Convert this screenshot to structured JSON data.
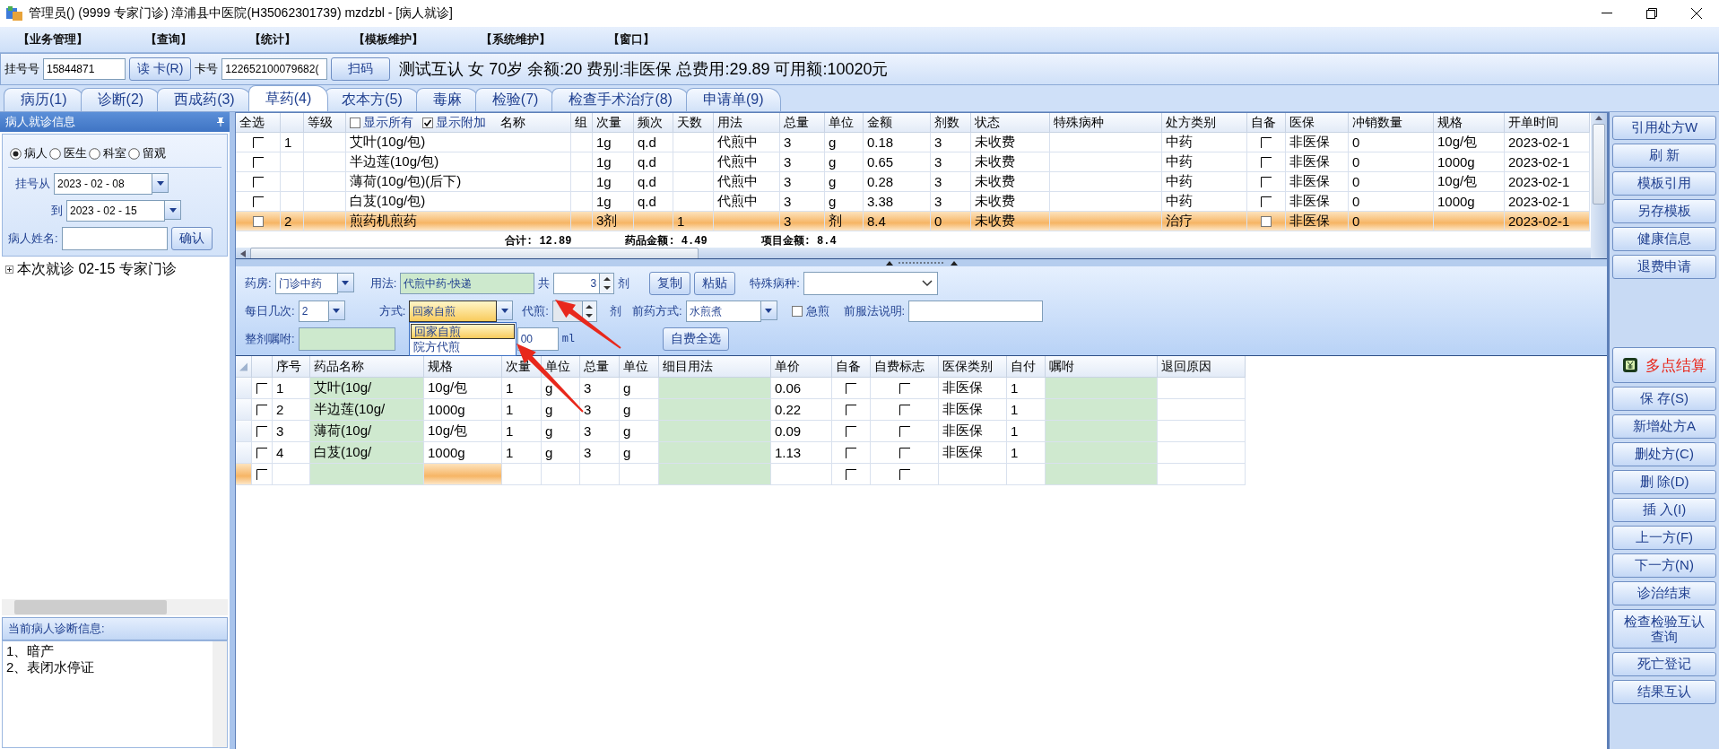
{
  "window": {
    "title": "管理员() (9999 专家门诊) 漳浦县中医院(H35062301739) mzdzbl - [病人就诊]"
  },
  "menu": [
    "【业务管理】",
    "【查询】",
    "【统计】",
    "【模板维护】",
    "【系统维护】",
    "【窗口】"
  ],
  "patient_bar": {
    "registration": {
      "label": "挂号号",
      "value": "15844871"
    },
    "read_card_button": "读 卡(R)",
    "card": {
      "label": "卡号",
      "value": "122652100079682("
    },
    "scan_button": "扫码",
    "info": "测试互认 女 70岁 余额:20 费别:非医保 总费用:29.89 可用额:10020元"
  },
  "tabs": [
    {
      "label": "病历(1)",
      "selected": false
    },
    {
      "label": "诊断(2)",
      "selected": false
    },
    {
      "label": "西成药(3)",
      "selected": false
    },
    {
      "label": "草药(4)",
      "selected": true
    },
    {
      "label": "农本方(5)",
      "selected": false
    },
    {
      "label": "毒麻",
      "selected": false
    },
    {
      "label": "检验(7)",
      "selected": false
    },
    {
      "label": "检查手术治疗(8)",
      "selected": false
    },
    {
      "label": "申请单(9)",
      "selected": false
    }
  ],
  "left_panel": {
    "title": "病人就诊信息",
    "scope": [
      {
        "label": "病人",
        "selected": true
      },
      {
        "label": "医生",
        "selected": false
      },
      {
        "label": "科室",
        "selected": false
      },
      {
        "label": "留观",
        "selected": false
      }
    ],
    "date_from": {
      "label": "挂号从",
      "value": "2023 - 02 - 08"
    },
    "date_to": {
      "label": "到",
      "value": "2023 - 02 - 15"
    },
    "patient_name": {
      "label": "病人姓名:"
    },
    "confirm_button": "确认",
    "tree": [
      {
        "label": "本次就诊 02-15 专家门诊",
        "expanded": false
      }
    ],
    "diagnosis": {
      "title": "当前病人诊断信息:",
      "lines": [
        "1、暗产",
        "2、表闭水停证"
      ]
    }
  },
  "top_table": {
    "columns": [
      {
        "label": "全选"
      },
      {
        "kind": "blank"
      },
      {
        "label": "等级"
      },
      {
        "kind": "name",
        "label": "名称",
        "toggles": [
          {
            "label": "显示所有",
            "checked": false
          },
          {
            "label": "显示附加",
            "checked": true
          }
        ]
      },
      {
        "label": "组"
      },
      {
        "label": "次量"
      },
      {
        "label": "频次"
      },
      {
        "label": "天数"
      },
      {
        "label": "用法"
      },
      {
        "label": "总量"
      },
      {
        "label": "单位"
      },
      {
        "label": "金额"
      },
      {
        "label": "剂数"
      },
      {
        "label": "状态"
      },
      {
        "label": "特殊病种"
      },
      {
        "label": "处方类别"
      },
      {
        "label": "自备"
      },
      {
        "label": "医保"
      },
      {
        "label": "冲销数量"
      },
      {
        "label": "规格"
      },
      {
        "label": "开单时间"
      }
    ],
    "rows": [
      {
        "selected": false,
        "checked": false,
        "group_no": "1",
        "name": "艾叶(10g/包)",
        "dose": "1g",
        "frequency": "q.d",
        "usage": "代煎中",
        "total": "3",
        "unit": "g",
        "amount": "0.18",
        "doses": "3",
        "status": "未收费",
        "rx_type": "中药",
        "self_supplied": false,
        "insurance": "非医保",
        "offset_qty": "0",
        "spec": "10g/包",
        "start_time": "2023-02-1"
      },
      {
        "selected": false,
        "checked": false,
        "name": "半边莲(10g/包)",
        "dose": "1g",
        "frequency": "q.d",
        "usage": "代煎中",
        "total": "3",
        "unit": "g",
        "amount": "0.65",
        "doses": "3",
        "status": "未收费",
        "rx_type": "中药",
        "self_supplied": false,
        "insurance": "非医保",
        "offset_qty": "0",
        "spec": "1000g",
        "start_time": "2023-02-1"
      },
      {
        "selected": false,
        "checked": false,
        "name": "薄荷(10g/包)(后下)",
        "dose": "1g",
        "frequency": "q.d",
        "usage": "代煎中",
        "total": "3",
        "unit": "g",
        "amount": "0.28",
        "doses": "3",
        "status": "未收费",
        "rx_type": "中药",
        "self_supplied": false,
        "insurance": "非医保",
        "offset_qty": "0",
        "spec": "10g/包",
        "start_time": "2023-02-1"
      },
      {
        "selected": false,
        "checked": false,
        "name": "白芨(10g/包)",
        "dose": "1g",
        "frequency": "q.d",
        "usage": "代煎中",
        "total": "3",
        "unit": "g",
        "amount": "3.38",
        "doses": "3",
        "status": "未收费",
        "rx_type": "中药",
        "self_supplied": false,
        "insurance": "非医保",
        "offset_qty": "0",
        "spec": "1000g",
        "start_time": "2023-02-1"
      },
      {
        "selected": true,
        "checked": false,
        "group_no": "2",
        "name": "煎药机煎药",
        "dose": "3剂",
        "days": "1",
        "total": "3",
        "unit": "剂",
        "amount": "8.4",
        "doses": "0",
        "status": "未收费",
        "rx_type": "治疗",
        "self_supplied": false,
        "insurance": "非医保",
        "offset_qty": "0",
        "start_time": "2023-02-1"
      }
    ],
    "summary": [
      {
        "label": "合计:",
        "value": "12.89"
      },
      {
        "label": "药品金额:",
        "value": "4.49"
      },
      {
        "label": "项目金额:",
        "value": "8.4"
      }
    ]
  },
  "form": {
    "pharmacy": {
      "label": "药房:",
      "value": "门诊中药"
    },
    "usage": {
      "label": "用法:",
      "value": "代煎中药-快递"
    },
    "total": {
      "label": "共",
      "value": "3",
      "unit": "剂"
    },
    "copy_button": "复制",
    "paste_button": "粘贴",
    "special_disease": {
      "label": "特殊病种:"
    },
    "daily_times": {
      "label": "每日几次:",
      "value": "2"
    },
    "method": {
      "label": "方式:",
      "value": "回家自煎",
      "expanded": true,
      "options": [
        {
          "label": "回家自煎",
          "selected": true
        },
        {
          "label": "院方代煎",
          "selected": false
        }
      ]
    },
    "decoct": {
      "label": "代煎:",
      "unit": "剂",
      "disabled": true
    },
    "decoct_method": {
      "label": "前药方式:",
      "value": "水煎煮"
    },
    "urgent": {
      "label": "急煎",
      "checked": false
    },
    "instructions": {
      "label": "前服法说明:"
    },
    "whole_advice": {
      "label": "整剂嘱咐:"
    },
    "volume": {
      "value": "00",
      "unit": "ml"
    },
    "self_pay_all_button": "自费全选"
  },
  "bottom_table": {
    "columns": [
      "序号",
      "药品名称",
      "规格",
      "次量",
      "单位",
      "总量",
      "单位",
      "细目用法",
      "单价",
      "自备",
      "自费标志",
      "医保类别",
      "自付",
      "嘱咐",
      "退回原因"
    ],
    "rows": [
      {
        "current": false,
        "checked": false,
        "no": "1",
        "name": "艾叶(10g/",
        "spec": "10g/包",
        "dose": "1",
        "unit": "g",
        "total": "3",
        "total_unit": "g",
        "price": "0.06",
        "self_supplied": false,
        "self_pay": false,
        "insurance_type": "非医保",
        "self_pay_ratio": "1"
      },
      {
        "current": false,
        "checked": false,
        "no": "2",
        "name": "半边莲(10g/",
        "spec": "1000g",
        "dose": "1",
        "unit": "g",
        "total": "3",
        "total_unit": "g",
        "price": "0.22",
        "self_supplied": false,
        "self_pay": false,
        "insurance_type": "非医保",
        "self_pay_ratio": "1"
      },
      {
        "current": false,
        "checked": false,
        "no": "3",
        "name": "薄荷(10g/",
        "spec": "10g/包",
        "dose": "1",
        "unit": "g",
        "total": "3",
        "total_unit": "g",
        "price": "0.09",
        "self_supplied": false,
        "self_pay": false,
        "insurance_type": "非医保",
        "self_pay_ratio": "1"
      },
      {
        "current": false,
        "checked": false,
        "no": "4",
        "name": "白芨(10g/",
        "spec": "1000g",
        "dose": "1",
        "unit": "g",
        "total": "3",
        "total_unit": "g",
        "price": "1.13",
        "self_supplied": false,
        "self_pay": false,
        "insurance_type": "非医保",
        "self_pay_ratio": "1"
      },
      {
        "current": true,
        "checked": false,
        "self_supplied": false,
        "self_pay": false
      }
    ]
  },
  "right_buttons": [
    {
      "label": "引用处方W",
      "kind": "plain"
    },
    {
      "label": "刷 新",
      "kind": "plain"
    },
    {
      "label": "模板引用",
      "kind": "plain"
    },
    {
      "label": "另存模板",
      "kind": "plain"
    },
    {
      "label": "健康信息",
      "kind": "plain"
    },
    {
      "label": "退费申请",
      "kind": "plain"
    },
    {
      "label": "多点结算",
      "kind": "settle"
    },
    {
      "label": "保 存(S)",
      "kind": "plain"
    },
    {
      "label": "新增处方A",
      "kind": "plain"
    },
    {
      "label": "删处方(C)",
      "kind": "plain"
    },
    {
      "label": "删 除(D)",
      "kind": "plain"
    },
    {
      "label": "插 入(I)",
      "kind": "plain"
    },
    {
      "label": "上一方(F)",
      "kind": "plain"
    },
    {
      "label": "下一方(N)",
      "kind": "plain"
    },
    {
      "label": "诊治结束",
      "kind": "plain"
    },
    {
      "label": "检查检验互认查询",
      "kind": "tall"
    },
    {
      "label": "死亡登记",
      "kind": "plain"
    },
    {
      "label": "结果互认",
      "kind": "plain"
    }
  ]
}
